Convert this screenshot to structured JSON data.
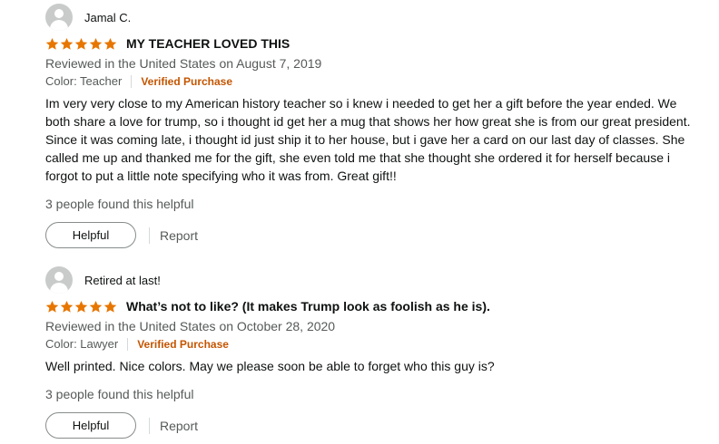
{
  "colors": {
    "star": "#e77600",
    "verified": "#c45500",
    "meta": "#565959"
  },
  "reviews": [
    {
      "profile_name": "Jamal C.",
      "rating": 5,
      "title": "MY TEACHER LOVED THIS",
      "date_line": "Reviewed in the United States on August 7, 2019",
      "format": "Color: Teacher",
      "verified": "Verified Purchase",
      "body": "Im very very close to my American history teacher so i knew i needed to get her a gift before the year ended. We both share a love for trump, so i thought id get her a mug that shows her how great she is from our great president. Since it was coming late, i thought id just ship it to her house, but i gave her a card on our last day of classes. She called me up and thanked me for the gift, she even told me that she thought she ordered it for herself because i forgot to put a little note specifying who it was from. Great gift!!",
      "helpful_count": "3 people found this helpful",
      "helpful_label": "Helpful",
      "report_label": "Report"
    },
    {
      "profile_name": "Retired at last!",
      "rating": 5,
      "title": "What’s not to like? (It makes Trump look as foolish as he is).",
      "date_line": "Reviewed in the United States on October 28, 2020",
      "format": "Color: Lawyer",
      "verified": "Verified Purchase",
      "body": "Well printed. Nice colors. May we please soon be able to forget who this guy is?",
      "helpful_count": "3 people found this helpful",
      "helpful_label": "Helpful",
      "report_label": "Report"
    }
  ]
}
